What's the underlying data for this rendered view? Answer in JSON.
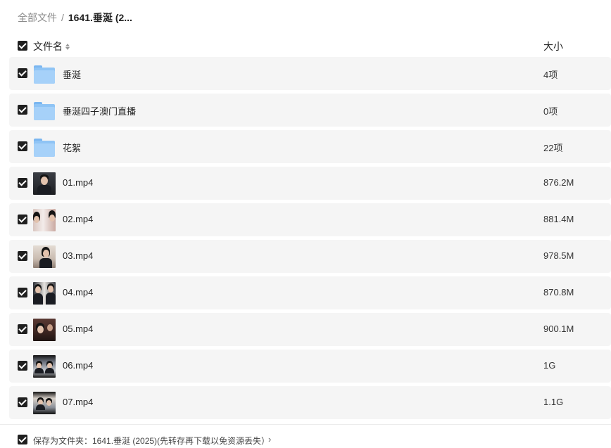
{
  "breadcrumb": {
    "root": "全部文件",
    "separator": "/",
    "current": "1641.垂涎 (2..."
  },
  "header": {
    "name_label": "文件名",
    "size_label": "大小"
  },
  "files": [
    {
      "name": "垂涎",
      "size": "4项",
      "kind": "folder"
    },
    {
      "name": "垂涎四子澳门直播",
      "size": "0项",
      "kind": "folder"
    },
    {
      "name": "花絮",
      "size": "22项",
      "kind": "folder"
    },
    {
      "name": "01.mp4",
      "size": "876.2M",
      "kind": "video"
    },
    {
      "name": "02.mp4",
      "size": "881.4M",
      "kind": "video"
    },
    {
      "name": "03.mp4",
      "size": "978.5M",
      "kind": "video"
    },
    {
      "name": "04.mp4",
      "size": "870.8M",
      "kind": "video"
    },
    {
      "name": "05.mp4",
      "size": "900.1M",
      "kind": "video"
    },
    {
      "name": "06.mp4",
      "size": "1G",
      "kind": "video"
    },
    {
      "name": "07.mp4",
      "size": "1.1G",
      "kind": "video"
    }
  ],
  "footer": {
    "save_text": "保存为文件夹：1641.垂涎 (2025)(先转存再下载以免资源丢失）",
    "chevron": "›"
  },
  "colors": {
    "checkbox": "#1f1f1f",
    "row_bg": "#f5f5f5",
    "folder": "#8fc4f5"
  }
}
